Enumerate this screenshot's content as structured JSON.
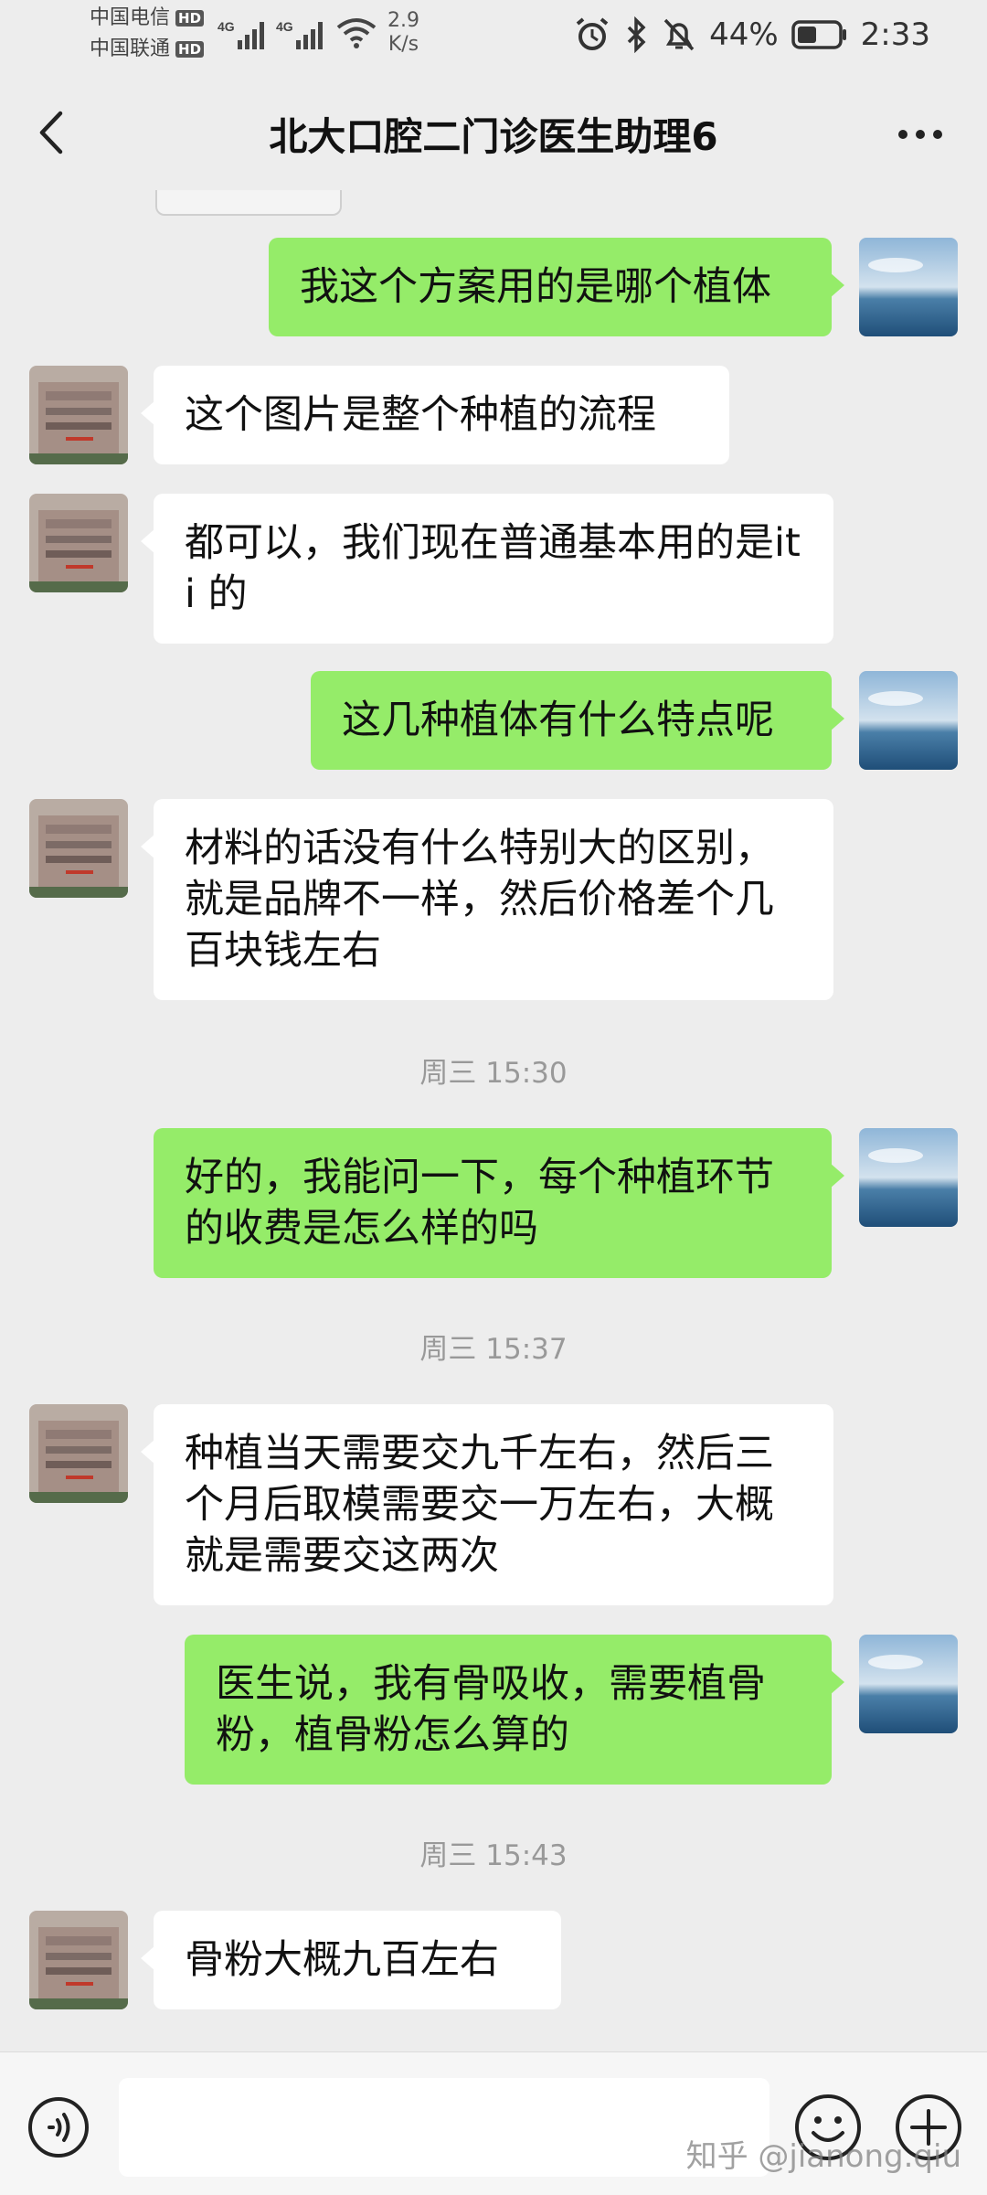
{
  "status_bar": {
    "carrier_1": "中国电信",
    "carrier_2": "中国联通",
    "hd_label": "HD",
    "net_speed_value": "2.9",
    "net_speed_unit": "K/s",
    "battery_percent": "44%",
    "time": "2:33"
  },
  "header": {
    "title": "北大口腔二门诊医生助理6"
  },
  "messages": [
    {
      "side": "out",
      "text": "我这个方案用的是哪个植体"
    },
    {
      "side": "in",
      "text": "这个图片是整个种植的流程"
    },
    {
      "side": "in",
      "text": "都可以，我们现在普通基本用的是iti 的"
    },
    {
      "side": "out",
      "text": "这几种植体有什么特点呢"
    },
    {
      "side": "in",
      "text": "材料的话没有什么特别大的区别，就是品牌不一样，然后价格差个几百块钱左右"
    },
    {
      "side": "out",
      "text": "好的，我能问一下，每个种植环节的收费是怎么样的吗"
    },
    {
      "side": "in",
      "text": "种植当天需要交九千左右，然后三个月后取模需要交一万左右，大概就是需要交这两次"
    },
    {
      "side": "out",
      "text": "医生说，我有骨吸收，需要植骨粉，植骨粉怎么算的"
    },
    {
      "side": "in",
      "text": "骨粉大概九百左右"
    }
  ],
  "timestamps": [
    "周三 15:30",
    "周三 15:37",
    "周三 15:43"
  ],
  "input_bar": {
    "watermark": "知乎 @jianong.qiu"
  },
  "icons": {
    "back": "chevron-left-icon",
    "more": "more-dots-icon",
    "voice": "voice-icon",
    "emoji": "emoji-icon",
    "plus": "plus-icon"
  },
  "colors": {
    "outgoing_bubble": "#95ec69",
    "incoming_bubble": "#ffffff",
    "background": "#ededed"
  }
}
